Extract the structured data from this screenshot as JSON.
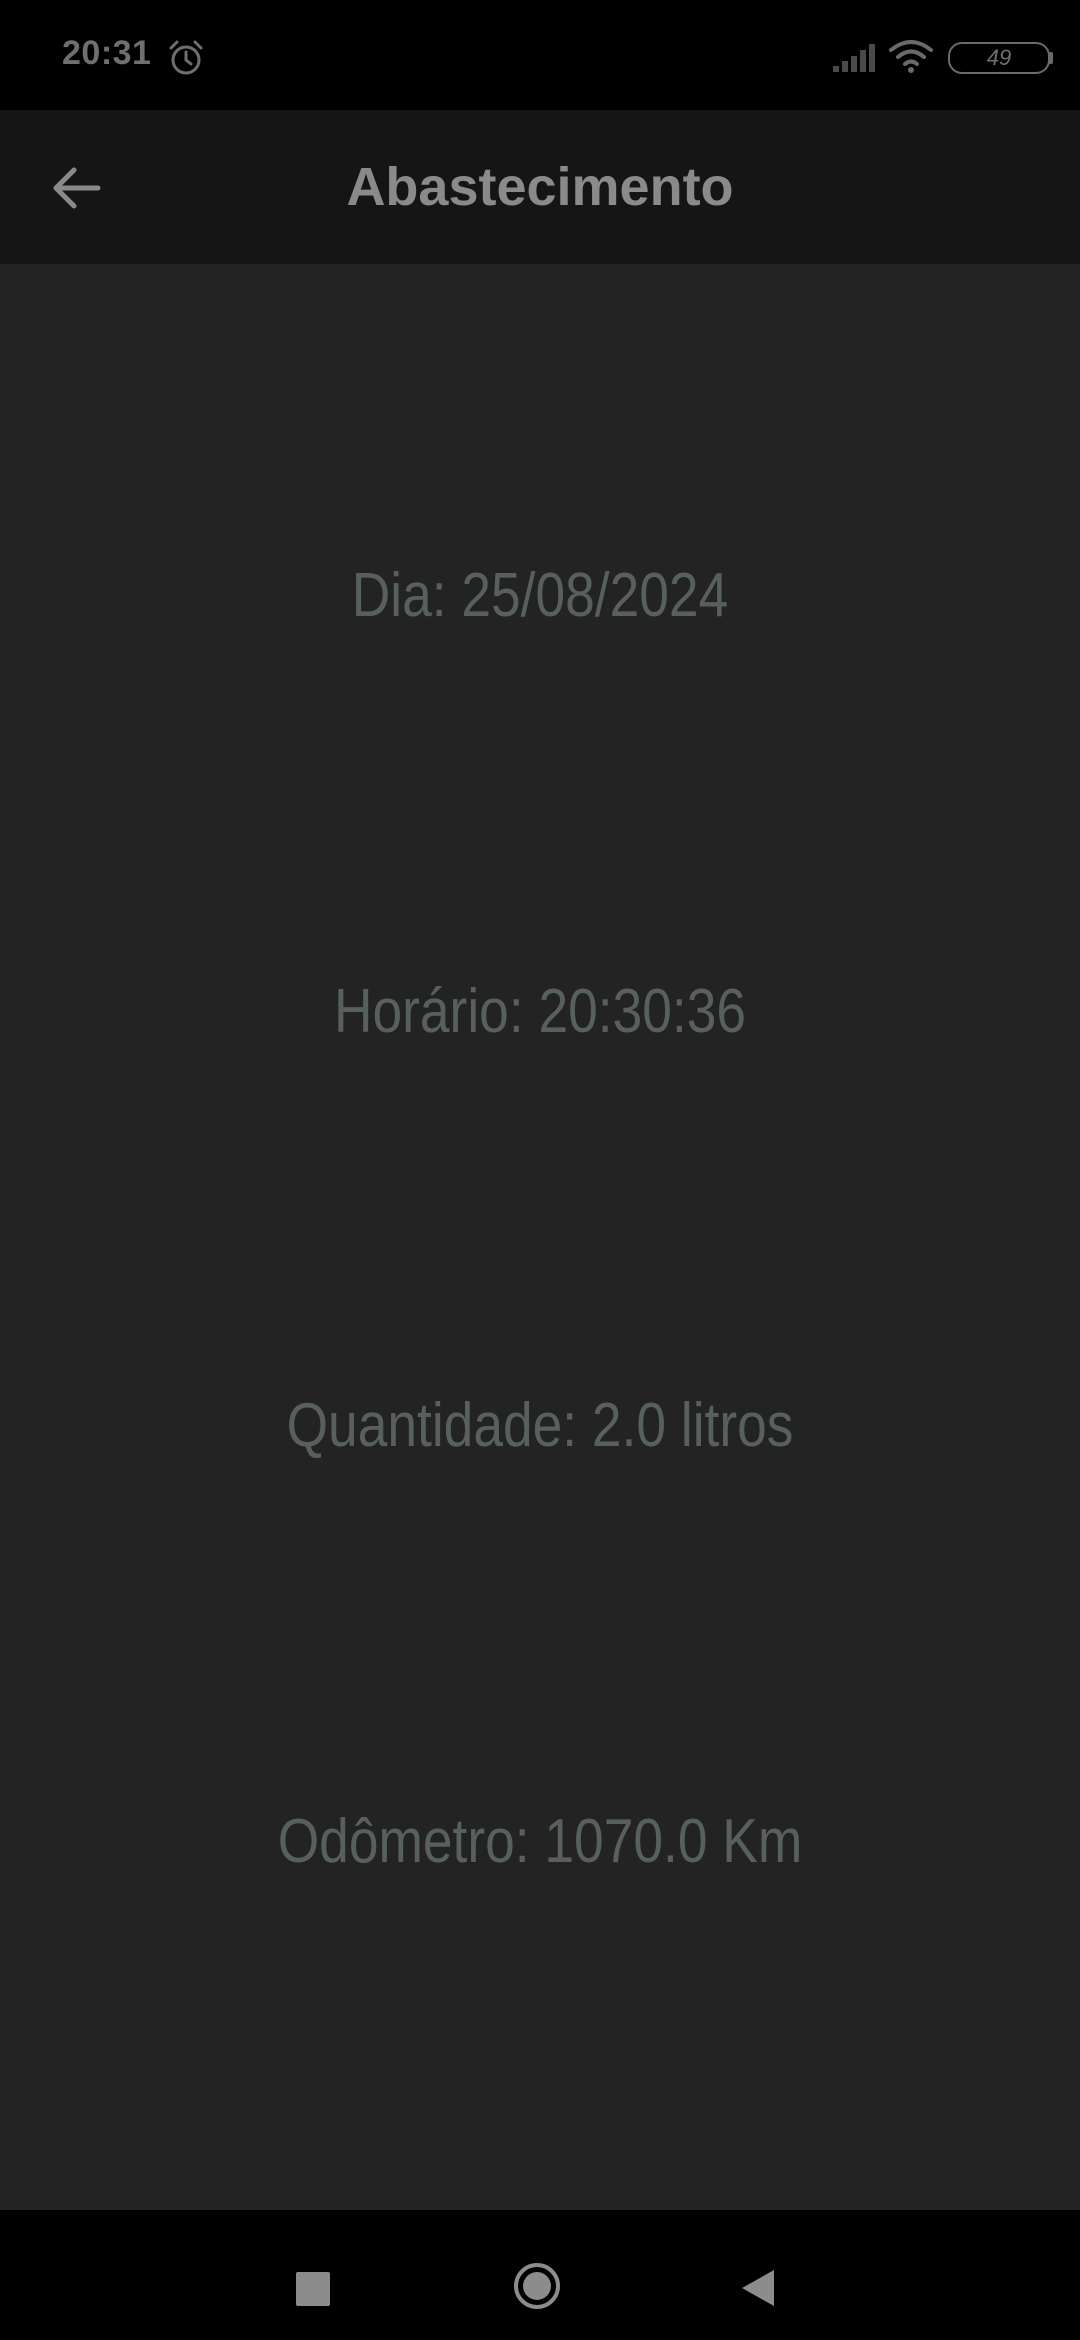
{
  "status_bar": {
    "time": "20:31",
    "alarm_icon": "alarm-clock-icon",
    "signal_icon": "cellular-signal-icon",
    "wifi_icon": "wifi-icon",
    "battery_level": "49"
  },
  "app_bar": {
    "back_icon": "arrow-left-icon",
    "title": "Abastecimento"
  },
  "details": {
    "day": "Dia: 25/08/2024",
    "time": "Horário: 20:30:36",
    "quantity": "Quantidade: 2.0 litros",
    "odometer": "Odômetro: 1070.0 Km"
  },
  "nav_bar": {
    "recents_icon": "square-recents-icon",
    "home_icon": "circle-home-icon",
    "back_icon": "triangle-back-icon"
  },
  "colors": {
    "status_bar_bg": "#000000",
    "app_bar_bg": "#151515",
    "content_bg": "#232323",
    "title_text": "#8a8a8a",
    "detail_text": "#58605f"
  }
}
